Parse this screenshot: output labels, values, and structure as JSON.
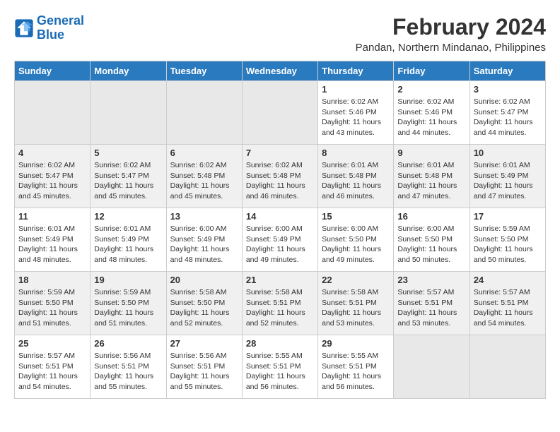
{
  "logo": {
    "line1": "General",
    "line2": "Blue"
  },
  "title": "February 2024",
  "subtitle": "Pandan, Northern Mindanao, Philippines",
  "weekdays": [
    "Sunday",
    "Monday",
    "Tuesday",
    "Wednesday",
    "Thursday",
    "Friday",
    "Saturday"
  ],
  "weeks": [
    [
      {
        "day": "",
        "info": ""
      },
      {
        "day": "",
        "info": ""
      },
      {
        "day": "",
        "info": ""
      },
      {
        "day": "",
        "info": ""
      },
      {
        "day": "1",
        "info": "Sunrise: 6:02 AM\nSunset: 5:46 PM\nDaylight: 11 hours and 43 minutes."
      },
      {
        "day": "2",
        "info": "Sunrise: 6:02 AM\nSunset: 5:46 PM\nDaylight: 11 hours and 44 minutes."
      },
      {
        "day": "3",
        "info": "Sunrise: 6:02 AM\nSunset: 5:47 PM\nDaylight: 11 hours and 44 minutes."
      }
    ],
    [
      {
        "day": "4",
        "info": "Sunrise: 6:02 AM\nSunset: 5:47 PM\nDaylight: 11 hours and 45 minutes."
      },
      {
        "day": "5",
        "info": "Sunrise: 6:02 AM\nSunset: 5:47 PM\nDaylight: 11 hours and 45 minutes."
      },
      {
        "day": "6",
        "info": "Sunrise: 6:02 AM\nSunset: 5:48 PM\nDaylight: 11 hours and 45 minutes."
      },
      {
        "day": "7",
        "info": "Sunrise: 6:02 AM\nSunset: 5:48 PM\nDaylight: 11 hours and 46 minutes."
      },
      {
        "day": "8",
        "info": "Sunrise: 6:01 AM\nSunset: 5:48 PM\nDaylight: 11 hours and 46 minutes."
      },
      {
        "day": "9",
        "info": "Sunrise: 6:01 AM\nSunset: 5:48 PM\nDaylight: 11 hours and 47 minutes."
      },
      {
        "day": "10",
        "info": "Sunrise: 6:01 AM\nSunset: 5:49 PM\nDaylight: 11 hours and 47 minutes."
      }
    ],
    [
      {
        "day": "11",
        "info": "Sunrise: 6:01 AM\nSunset: 5:49 PM\nDaylight: 11 hours and 48 minutes."
      },
      {
        "day": "12",
        "info": "Sunrise: 6:01 AM\nSunset: 5:49 PM\nDaylight: 11 hours and 48 minutes."
      },
      {
        "day": "13",
        "info": "Sunrise: 6:00 AM\nSunset: 5:49 PM\nDaylight: 11 hours and 48 minutes."
      },
      {
        "day": "14",
        "info": "Sunrise: 6:00 AM\nSunset: 5:49 PM\nDaylight: 11 hours and 49 minutes."
      },
      {
        "day": "15",
        "info": "Sunrise: 6:00 AM\nSunset: 5:50 PM\nDaylight: 11 hours and 49 minutes."
      },
      {
        "day": "16",
        "info": "Sunrise: 6:00 AM\nSunset: 5:50 PM\nDaylight: 11 hours and 50 minutes."
      },
      {
        "day": "17",
        "info": "Sunrise: 5:59 AM\nSunset: 5:50 PM\nDaylight: 11 hours and 50 minutes."
      }
    ],
    [
      {
        "day": "18",
        "info": "Sunrise: 5:59 AM\nSunset: 5:50 PM\nDaylight: 11 hours and 51 minutes."
      },
      {
        "day": "19",
        "info": "Sunrise: 5:59 AM\nSunset: 5:50 PM\nDaylight: 11 hours and 51 minutes."
      },
      {
        "day": "20",
        "info": "Sunrise: 5:58 AM\nSunset: 5:50 PM\nDaylight: 11 hours and 52 minutes."
      },
      {
        "day": "21",
        "info": "Sunrise: 5:58 AM\nSunset: 5:51 PM\nDaylight: 11 hours and 52 minutes."
      },
      {
        "day": "22",
        "info": "Sunrise: 5:58 AM\nSunset: 5:51 PM\nDaylight: 11 hours and 53 minutes."
      },
      {
        "day": "23",
        "info": "Sunrise: 5:57 AM\nSunset: 5:51 PM\nDaylight: 11 hours and 53 minutes."
      },
      {
        "day": "24",
        "info": "Sunrise: 5:57 AM\nSunset: 5:51 PM\nDaylight: 11 hours and 54 minutes."
      }
    ],
    [
      {
        "day": "25",
        "info": "Sunrise: 5:57 AM\nSunset: 5:51 PM\nDaylight: 11 hours and 54 minutes."
      },
      {
        "day": "26",
        "info": "Sunrise: 5:56 AM\nSunset: 5:51 PM\nDaylight: 11 hours and 55 minutes."
      },
      {
        "day": "27",
        "info": "Sunrise: 5:56 AM\nSunset: 5:51 PM\nDaylight: 11 hours and 55 minutes."
      },
      {
        "day": "28",
        "info": "Sunrise: 5:55 AM\nSunset: 5:51 PM\nDaylight: 11 hours and 56 minutes."
      },
      {
        "day": "29",
        "info": "Sunrise: 5:55 AM\nSunset: 5:51 PM\nDaylight: 11 hours and 56 minutes."
      },
      {
        "day": "",
        "info": ""
      },
      {
        "day": "",
        "info": ""
      }
    ]
  ]
}
